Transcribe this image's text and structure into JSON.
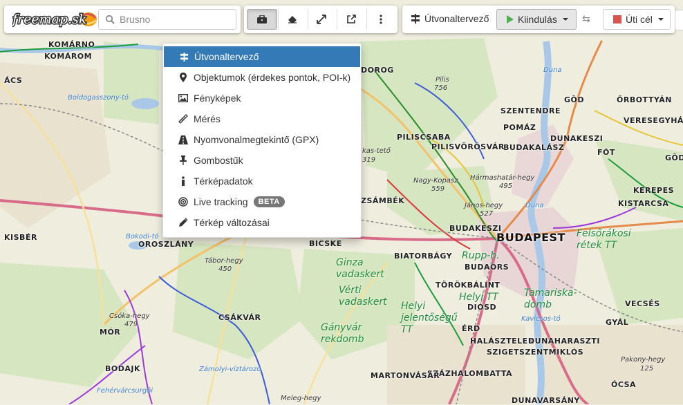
{
  "app": {
    "logo_text": "freemap.sk"
  },
  "search": {
    "placeholder": "Brusno",
    "icon": "search-icon"
  },
  "toolbar": {
    "buttons": [
      {
        "name": "tools-button",
        "icon": "briefcase-icon",
        "active": true
      },
      {
        "name": "eraser-button",
        "icon": "eraser-icon",
        "active": false
      },
      {
        "name": "fullscreen-button",
        "icon": "expand-icon",
        "active": false
      },
      {
        "name": "external-link-button",
        "icon": "external-link-icon",
        "active": false
      },
      {
        "name": "more-button",
        "icon": "vertical-dots-icon",
        "active": false
      }
    ]
  },
  "route": {
    "title": "Útvonaltervező",
    "start_label": "Kiindulás",
    "swap_symbol": "⇆",
    "goal_label": "Úti cél",
    "start_color": "#4cae4c",
    "goal_color": "#d9534f"
  },
  "menu": {
    "items": [
      {
        "label": "Útvonaltervező",
        "icon": "route-planner-icon",
        "selected": true
      },
      {
        "label": "Objektumok (érdekes pontok, POI-k)",
        "icon": "map-marker-icon",
        "selected": false
      },
      {
        "label": "Fényképek",
        "icon": "picture-icon",
        "selected": false
      },
      {
        "label": "Mérés",
        "icon": "ruler-icon",
        "selected": false
      },
      {
        "label": "Nyomvonalmegtekintő (GPX)",
        "icon": "road-icon",
        "selected": false
      },
      {
        "label": "Gombostűk",
        "icon": "pushpin-icon",
        "selected": false
      },
      {
        "label": "Térképadatok",
        "icon": "info-icon",
        "selected": false
      },
      {
        "label": "Live tracking",
        "icon": "bullseye-icon",
        "selected": false,
        "badge": "BETA"
      },
      {
        "label": "Térkép változásai",
        "icon": "pencil-icon",
        "selected": false
      }
    ],
    "accent_color": "#337ab7"
  },
  "map": {
    "towns": [
      "KOMÁRNO",
      "KOMÁROM",
      "ÁCS",
      "OROSZLÁNY",
      "BICSKE",
      "CSÁKVÁR",
      "MÓR",
      "BODAJK",
      "KISBÉR",
      "BIATORBÁGY",
      "BUDAÖRS",
      "TÖRÖKBÁLINT",
      "DIÓSD",
      "ÉRD",
      "HALÁSZTELEK",
      "DUNAHARASZTI",
      "SZIGETSZENTMIKLÓS",
      "SZÁZHALOMBATTA",
      "MARTONVÁSÁR",
      "DUNAVARSÁNY",
      "ÓCSA",
      "GYÁL",
      "VECSÉS",
      "KISTARCSA",
      "KEREPES",
      "FÓT",
      "DUNAKESZI",
      "GÖD",
      "ŐRBOTTYÁN",
      "VERESEGYHÁZ",
      "SZENTENDRE",
      "POMÁZ",
      "BUDAKALÁSZ",
      "PILISCSABA",
      "PILISVÖRÖSVÁR",
      "BUDAKESZI",
      "ZSÁMBÉK",
      "DOROG",
      "GÖDÖ",
      "KISBÉR"
    ],
    "city": "BUDAPEST",
    "peaks": [
      {
        "name": "Pilis",
        "elev": "756"
      },
      {
        "name": "Nagy-Kopasz",
        "elev": "559"
      },
      {
        "name": "Hármashatár-hegy",
        "elev": "495"
      },
      {
        "name": "János-hegy",
        "elev": "527"
      },
      {
        "name": "Tábor-hegy",
        "elev": "450"
      },
      {
        "name": "Csóka-hegy",
        "elev": "479"
      },
      {
        "name": "Pakony-hegy",
        "elev": "125"
      },
      {
        "name": "Meleg-hegy",
        "elev": ""
      },
      {
        "name": "kas-tető",
        "elev": "319"
      }
    ],
    "water": [
      "Boldogasszony-tó",
      "Duna",
      "Duna",
      "Bokodi-tó",
      "Kavicsos-tó",
      "Zámolyi-víztározó",
      "Fehérvárcsurgói"
    ],
    "areas": [
      "Ginza vadaskert",
      "Vérti vadaskert",
      "Gányvár rekdomb",
      "Rupp-h.",
      "Helyi jelentőségű TT",
      "Helyi TT",
      "Tamariska-domb",
      "Felsőrákosi rétek TT"
    ]
  }
}
